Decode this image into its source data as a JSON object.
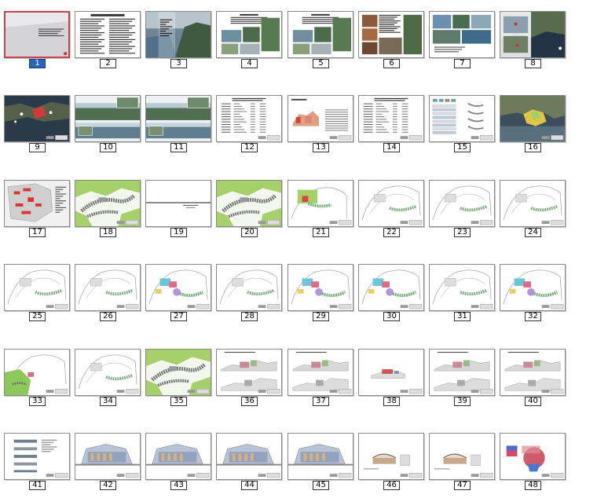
{
  "selected_page": "1",
  "pages": [
    {
      "label": "1",
      "kind": "title"
    },
    {
      "label": "2",
      "kind": "text"
    },
    {
      "label": "3",
      "kind": "coast"
    },
    {
      "label": "4",
      "kind": "photos-text"
    },
    {
      "label": "5",
      "kind": "photos-text"
    },
    {
      "label": "6",
      "kind": "brown-photos"
    },
    {
      "label": "7",
      "kind": "photo-row"
    },
    {
      "label": "8",
      "kind": "aerial"
    },
    {
      "label": "9",
      "kind": "aerial-red"
    },
    {
      "label": "10",
      "kind": "panorama"
    },
    {
      "label": "11",
      "kind": "panorama"
    },
    {
      "label": "12",
      "kind": "table"
    },
    {
      "label": "13",
      "kind": "table-drawing"
    },
    {
      "label": "14",
      "kind": "table"
    },
    {
      "label": "15",
      "kind": "elements"
    },
    {
      "label": "16",
      "kind": "aerial-site"
    },
    {
      "label": "17",
      "kind": "plan-red"
    },
    {
      "label": "18",
      "kind": "plan-green"
    },
    {
      "label": "19",
      "kind": "blank"
    },
    {
      "label": "20",
      "kind": "plan-green"
    },
    {
      "label": "21",
      "kind": "plan-partial"
    },
    {
      "label": "22",
      "kind": "plan-outline"
    },
    {
      "label": "23",
      "kind": "plan-outline"
    },
    {
      "label": "24",
      "kind": "plan-outline"
    },
    {
      "label": "25",
      "kind": "plan-outline"
    },
    {
      "label": "26",
      "kind": "plan-outline"
    },
    {
      "label": "27",
      "kind": "plan-color"
    },
    {
      "label": "28",
      "kind": "plan-outline"
    },
    {
      "label": "29",
      "kind": "plan-color"
    },
    {
      "label": "30",
      "kind": "plan-color"
    },
    {
      "label": "31",
      "kind": "plan-outline"
    },
    {
      "label": "32",
      "kind": "plan-color"
    },
    {
      "label": "33",
      "kind": "plan-greenleft"
    },
    {
      "label": "34",
      "kind": "plan-outline"
    },
    {
      "label": "35",
      "kind": "plan-green"
    },
    {
      "label": "36",
      "kind": "section"
    },
    {
      "label": "37",
      "kind": "section"
    },
    {
      "label": "38",
      "kind": "section-small"
    },
    {
      "label": "39",
      "kind": "section"
    },
    {
      "label": "40",
      "kind": "section"
    },
    {
      "label": "41",
      "kind": "elevations"
    },
    {
      "label": "42",
      "kind": "building"
    },
    {
      "label": "43",
      "kind": "building"
    },
    {
      "label": "44",
      "kind": "building"
    },
    {
      "label": "45",
      "kind": "building"
    },
    {
      "label": "46",
      "kind": "detail"
    },
    {
      "label": "47",
      "kind": "detail"
    },
    {
      "label": "48",
      "kind": "detail-color"
    }
  ]
}
